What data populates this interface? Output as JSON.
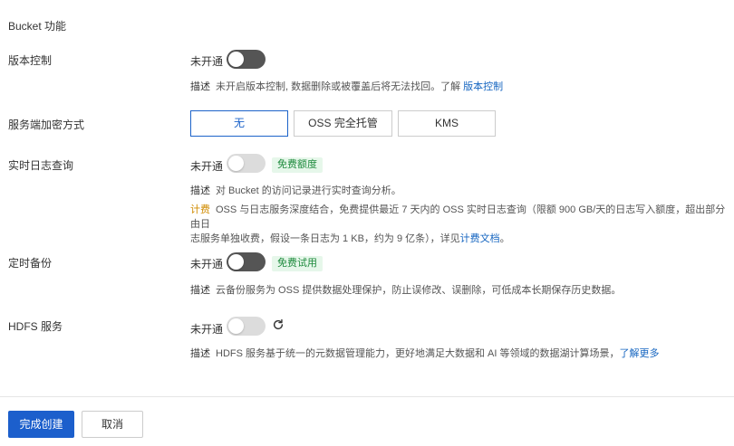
{
  "section_title": "Bucket 功能",
  "versioning": {
    "label": "版本控制",
    "status": "未开通",
    "desc_key": "描述",
    "desc_text": "未开启版本控制, 数据删除或被覆盖后将无法找回。了解 ",
    "desc_link": "版本控制"
  },
  "encryption": {
    "label": "服务端加密方式",
    "options": [
      "无",
      "OSS 完全托管",
      "KMS"
    ],
    "selected": "无"
  },
  "realtime_log": {
    "label": "实时日志查询",
    "status": "未开通",
    "badge": "免费额度",
    "desc_key": "描述",
    "desc_text": "对 Bucket 的访问记录进行实时查询分析。",
    "fee_key": "计费",
    "fee_line1": "OSS 与日志服务深度结合，免费提供最近 7 天内的 OSS 实时日志查询（限额 900 GB/天的日志写入额度，超出部分由日",
    "fee_line2": "志服务单独收费，假设一条日志为 1 KB，约为 9 亿条），详见",
    "fee_link": "计费文档",
    "fee_end": "。"
  },
  "backup": {
    "label": "定时备份",
    "status": "未开通",
    "badge": "免费试用",
    "desc_key": "描述",
    "desc_text": "云备份服务为 OSS 提供数据处理保护，防止误修改、误删除，可低成本长期保存历史数据。"
  },
  "hdfs": {
    "label": "HDFS 服务",
    "status": "未开通",
    "desc_key": "描述",
    "desc_text": "HDFS 服务基于统一的元数据管理能力，更好地满足大数据和 AI 等领域的数据湖计算场景，",
    "desc_link": "了解更多"
  },
  "footer": {
    "confirm_label": "完成创建",
    "cancel_label": "取消"
  },
  "colors": {
    "primary": "#1c5fcc",
    "link": "#1565c0",
    "badge_green": "#1d8a3c",
    "fee_orange": "#d08b00"
  }
}
